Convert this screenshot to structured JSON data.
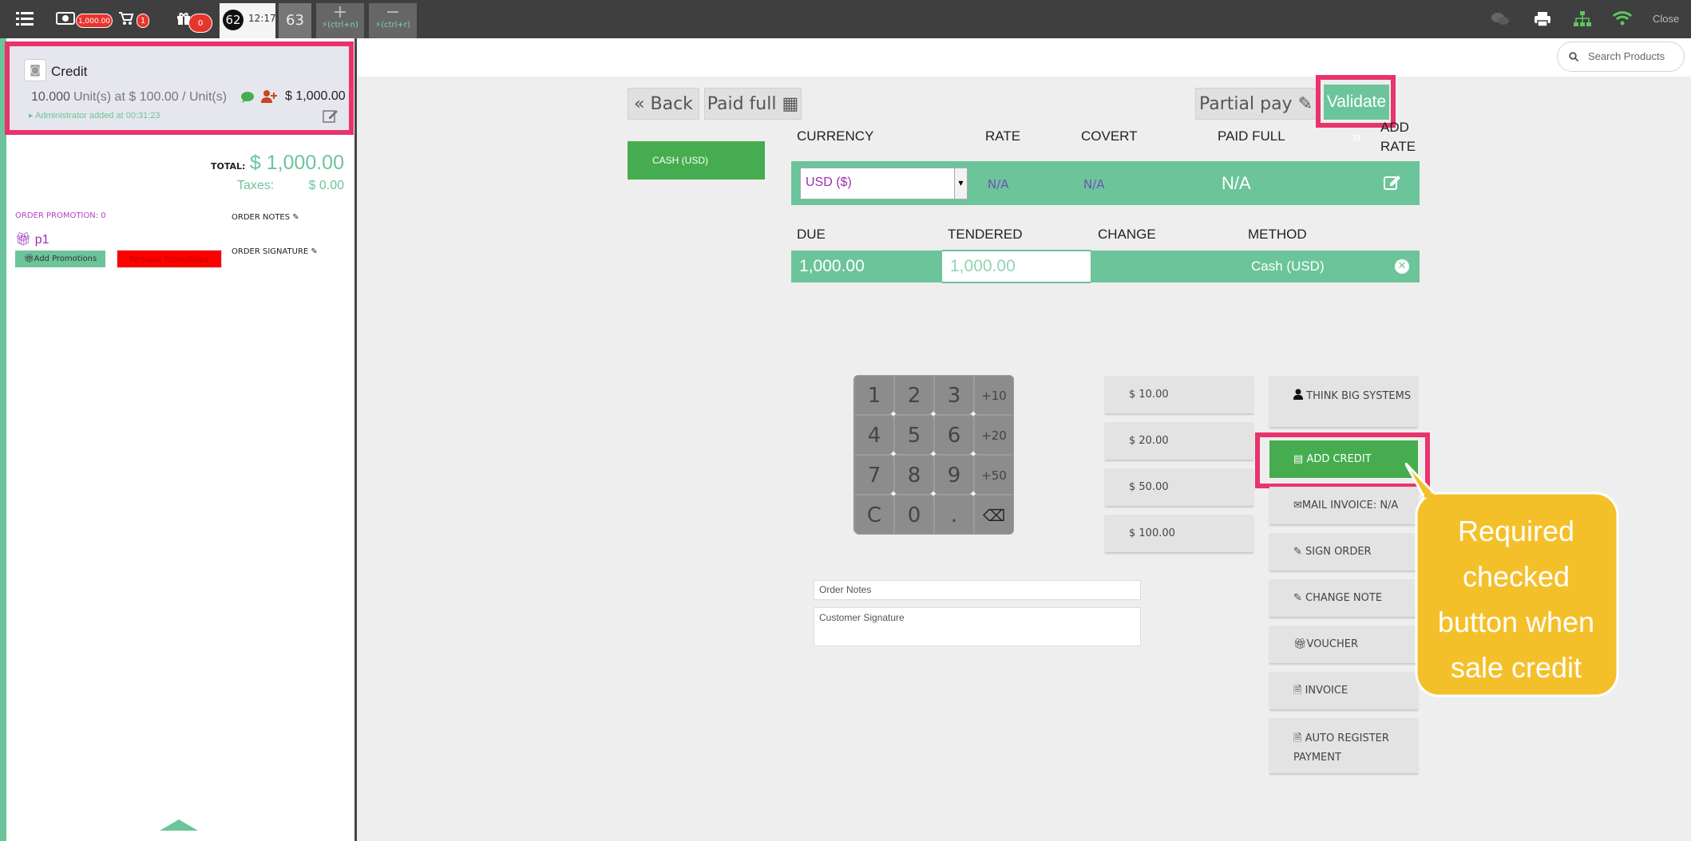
{
  "topbar": {
    "cash_badge": "1,000.00",
    "cart_badge": "1",
    "gift_badge": "0",
    "ticket_number": "62",
    "ticket_time": "12:17",
    "other_ticket": "63",
    "add_hotkey": "(ctrl+n)",
    "remove_hotkey": "(ctrl+r)",
    "close_label": "Close"
  },
  "search": {
    "placeholder": "Search Products"
  },
  "order": {
    "line": {
      "product_name": "Credit",
      "quantity": "10.000",
      "unit_text": "Unit(s) at $ 100.00 / Unit(s)",
      "price": "$ 1,000.00",
      "added_by": "Administrator added at 00:31:23"
    },
    "total_label": "TOTAL:",
    "total_value": "$ 1,000.00",
    "taxes_label": "Taxes:",
    "taxes_value": "$ 0.00",
    "promotion_label": "ORDER PROMOTION: 0",
    "promotion_name": "p1",
    "add_promotions_label": "Add Promotions",
    "remove_promotions_label": "Remove Promotions",
    "order_notes_label": "ORDER NOTES",
    "order_signature_label": "ORDER SIGNATURE"
  },
  "payment": {
    "back_label": "Back",
    "paid_full_label": "Paid full",
    "partial_pay_label": "Partial pay",
    "validate_label": "Validate",
    "method_button_label": "CASH (USD)",
    "currency_headers": [
      "CURRENCY",
      "RATE",
      "COVERT",
      "PAID FULL",
      "ADD RATE"
    ],
    "currency_row": {
      "currency": "USD ($)",
      "rate": "N/A",
      "covert": "N/A",
      "paid_full": "N/A"
    },
    "line_headers": [
      "DUE",
      "TENDERED",
      "CHANGE",
      "METHOD"
    ],
    "line_row": {
      "due": "1,000.00",
      "tendered": "1,000.00",
      "change": "",
      "method": "Cash (USD)"
    },
    "numpad": [
      "1",
      "2",
      "3",
      "+10",
      "4",
      "5",
      "6",
      "+20",
      "7",
      "8",
      "9",
      "+50",
      "C",
      "0",
      ".",
      "⌫"
    ],
    "quick_amounts": [
      "$ 10.00",
      "$ 20.00",
      "$ 50.00",
      "$ 100.00"
    ],
    "order_notes_placeholder": "Order Notes",
    "customer_signature_placeholder": "Customer Signature",
    "side_buttons": {
      "customer": "THINK BIG SYSTEMS",
      "add_credit": "ADD CREDIT",
      "mail_invoice": "MAIL INVOICE: N/A",
      "sign_order": "SIGN ORDER",
      "change_note": "CHANGE NOTE",
      "voucher": "VOUCHER",
      "invoice": "INVOICE",
      "auto_register": "AUTO REGISTER PAYMENT"
    }
  },
  "callout": {
    "text": "Required checked button when sale credit"
  },
  "colors": {
    "accent": "#6cc49b",
    "highlight": "#e8336b",
    "callout": "#f4c02a",
    "add_credit": "#45ad4f"
  }
}
